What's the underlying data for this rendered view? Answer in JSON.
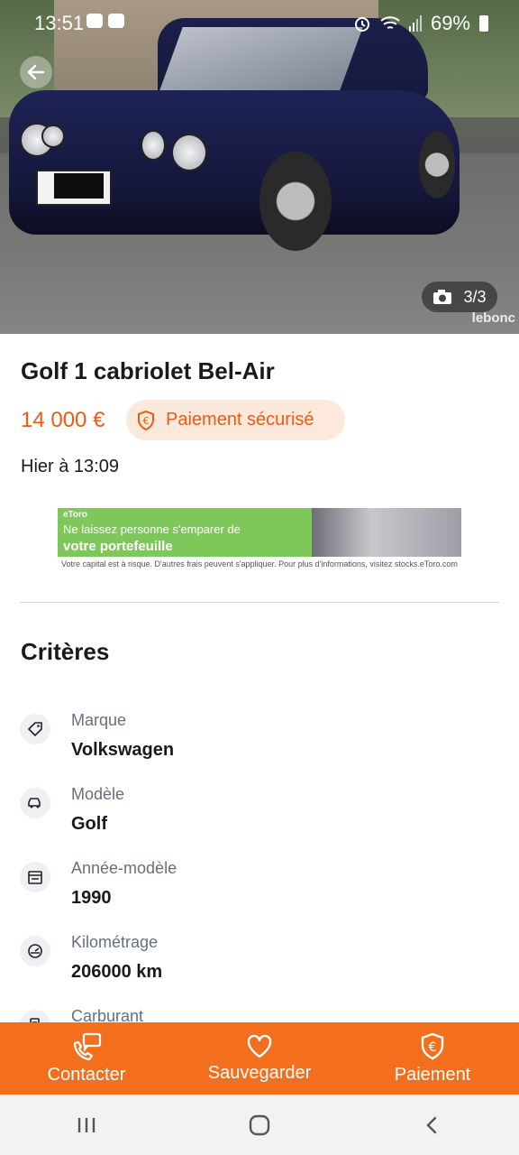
{
  "status_bar": {
    "time": "13:51",
    "battery": "69%"
  },
  "photo": {
    "counter": "3/3",
    "watermark": "leboncoin"
  },
  "listing": {
    "title": "Golf 1 cabriolet Bel-Air",
    "price": "14 000 €",
    "payment_badge": "Paiement sécurisé",
    "date": "Hier à 13:09"
  },
  "ad": {
    "brand": "eToro",
    "line1": "Ne laissez personne  s'emparer de",
    "line2": "votre portefeuille",
    "disclaimer": "Votre capital est à risque. D'autres frais peuvent s'appliquer. Pour plus d'informations,  visitez stocks.eToro.com"
  },
  "criteria": {
    "title": "Critères",
    "items": [
      {
        "label": "Marque",
        "value": "Volkswagen",
        "icon": "tag-icon"
      },
      {
        "label": "Modèle",
        "value": "Golf",
        "icon": "car-icon"
      },
      {
        "label": "Année-modèle",
        "value": "1990",
        "icon": "calendar-icon"
      },
      {
        "label": "Kilométrage",
        "value": "206000 km",
        "icon": "speedometer-icon"
      },
      {
        "label": "Carburant",
        "value": "",
        "icon": "fuel-icon"
      }
    ]
  },
  "bottom_bar": {
    "contact": "Contacter",
    "save": "Sauvegarder",
    "pay": "Paiement"
  },
  "colors": {
    "accent": "#f36f1d",
    "price": "#ec5a13",
    "badge_bg": "#fde9dc"
  }
}
